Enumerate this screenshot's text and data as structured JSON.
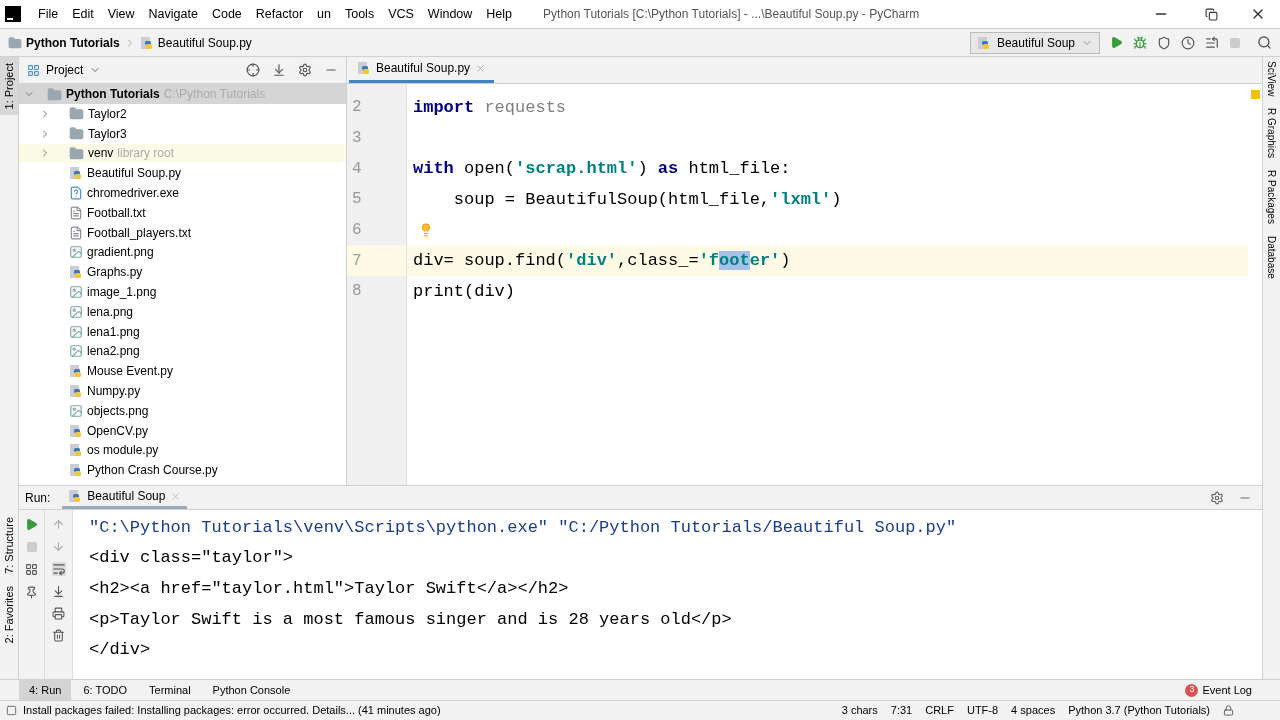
{
  "menu": [
    "File",
    "Edit",
    "View",
    "Navigate",
    "Code",
    "Refactor",
    "un",
    "Tools",
    "VCS",
    "Window",
    "Help"
  ],
  "window": {
    "title": "Python Tutorials [C:\\Python Tutorials] - ...\\Beautiful Soup.py - PyCharm"
  },
  "breadcrumbs": [
    "Python Tutorials",
    "Beautiful Soup.py"
  ],
  "run_config": "Beautiful Soup",
  "left_strip": [
    {
      "label": "1: Project",
      "selected": true
    },
    {
      "label": "7: Structure",
      "selected": false
    },
    {
      "label": "2: Favorites",
      "selected": false
    }
  ],
  "right_strip": [
    "SciView",
    "R Graphics",
    "R Packages",
    "Database"
  ],
  "project": {
    "title": "Project",
    "root": {
      "name": "Python Tutorials",
      "path": "C:\\Python Tutorials",
      "expanded": true
    },
    "items": [
      {
        "kind": "folder",
        "name": "Taylor2",
        "highlighted": false
      },
      {
        "kind": "folder",
        "name": "Taylor3",
        "highlighted": false
      },
      {
        "kind": "folder",
        "name": "venv",
        "note": "library root",
        "highlighted": true
      },
      {
        "kind": "python",
        "name": "Beautiful Soup.py",
        "highlighted": false
      },
      {
        "kind": "unknown",
        "name": "chromedriver.exe",
        "highlighted": false
      },
      {
        "kind": "text",
        "name": "Football.txt",
        "highlighted": false
      },
      {
        "kind": "text",
        "name": "Football_players.txt",
        "highlighted": false
      },
      {
        "kind": "image",
        "name": "gradient.png",
        "highlighted": false
      },
      {
        "kind": "python",
        "name": "Graphs.py",
        "highlighted": false
      },
      {
        "kind": "image",
        "name": "image_1.png",
        "highlighted": false
      },
      {
        "kind": "image",
        "name": "lena.png",
        "highlighted": false
      },
      {
        "kind": "image",
        "name": "lena1.png",
        "highlighted": false
      },
      {
        "kind": "image",
        "name": "lena2.png",
        "highlighted": false
      },
      {
        "kind": "python",
        "name": "Mouse Event.py",
        "highlighted": false
      },
      {
        "kind": "python",
        "name": "Numpy.py",
        "highlighted": false
      },
      {
        "kind": "image",
        "name": "objects.png",
        "highlighted": false
      },
      {
        "kind": "python",
        "name": "OpenCV.py",
        "highlighted": false
      },
      {
        "kind": "python",
        "name": "os module.py",
        "highlighted": false
      },
      {
        "kind": "python",
        "name": "Python Crash Course.py",
        "highlighted": false
      }
    ]
  },
  "editor": {
    "tab": "Beautiful Soup.py",
    "lines": [
      {
        "number": "2",
        "current": false,
        "tokens": [
          {
            "kind": "keyword",
            "text": "import"
          },
          {
            "kind": "unused",
            "text": " requests"
          }
        ]
      },
      {
        "number": "3",
        "current": false
      },
      {
        "number": "4",
        "current": false,
        "tokens": [
          {
            "kind": "keyword",
            "text": "with "
          },
          {
            "kind": "plain",
            "text": "open("
          },
          {
            "kind": "string",
            "text": "'scrap.html'"
          },
          {
            "kind": "plain",
            "text": ") "
          },
          {
            "kind": "keyword",
            "text": "as "
          },
          {
            "kind": "plain",
            "text": "html_file:"
          }
        ]
      },
      {
        "number": "5",
        "current": false,
        "tokens": [
          {
            "kind": "plain",
            "text": "    soup = BeautifulSoup(html_file,"
          },
          {
            "kind": "string",
            "text": "'lxml'"
          },
          {
            "kind": "plain",
            "text": ")"
          }
        ]
      },
      {
        "number": "6",
        "current": false,
        "bulb": true
      },
      {
        "number": "7",
        "current": true,
        "tokens": [
          {
            "kind": "plain",
            "text": "div= soup.find("
          },
          {
            "kind": "string",
            "text": "'div'"
          },
          {
            "kind": "plain",
            "text": ",class_="
          },
          {
            "kind": "string",
            "text": "'f"
          },
          {
            "kind": "selected",
            "text": "oot"
          },
          {
            "kind": "string",
            "text": "er'"
          },
          {
            "kind": "plain",
            "text": ")"
          }
        ]
      },
      {
        "number": "8",
        "current": false,
        "tokens": [
          {
            "kind": "plain",
            "text": "print(div)"
          }
        ]
      }
    ]
  },
  "run": {
    "label": "Run:",
    "tab": "Beautiful Soup",
    "output": [
      {
        "kind": "command",
        "text": "\"C:\\Python Tutorials\\venv\\Scripts\\python.exe\" \"C:/Python Tutorials/Beautiful Soup.py\""
      },
      {
        "kind": "output",
        "text": "<div class=\"taylor\">"
      },
      {
        "kind": "output",
        "text": "<h2><a href=\"taylor.html\">Taylor Swift</a></h2>"
      },
      {
        "kind": "output",
        "text": "<p>Taylor Swift is a most famous singer and is 28 years old</p>"
      },
      {
        "kind": "output",
        "text": "</div>"
      }
    ]
  },
  "tool_tabs": [
    {
      "label": "4: Run",
      "selected": true
    },
    {
      "label": "6: TODO",
      "selected": false
    },
    {
      "label": "Terminal",
      "selected": false
    },
    {
      "label": "Python Console",
      "selected": false
    }
  ],
  "event_log": {
    "count": "3",
    "label": "Event Log"
  },
  "status_bar": {
    "message": "Install packages failed: Installing packages: error occurred. Details... (41 minutes ago)",
    "items": [
      "3 chars",
      "7:31",
      "CRLF",
      "UTF-8",
      "4 spaces",
      "Python 3.7 (Python Tutorials)"
    ]
  }
}
